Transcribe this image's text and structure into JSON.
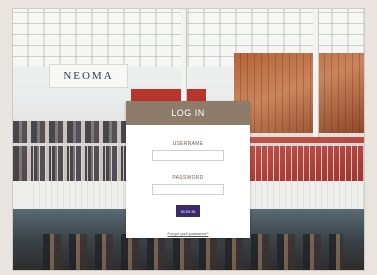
{
  "sign": {
    "text": "NEOMA"
  },
  "login": {
    "title": "LOG IN",
    "username_label": "USERNAME",
    "username_value": "",
    "password_label": "PASSWORD",
    "password_value": "",
    "signin_label": "SIGN IN",
    "forgot_label": "Forgot your password?"
  },
  "colors": {
    "header_bg": "#8e7c6b",
    "button_bg": "#3a2a6b"
  }
}
